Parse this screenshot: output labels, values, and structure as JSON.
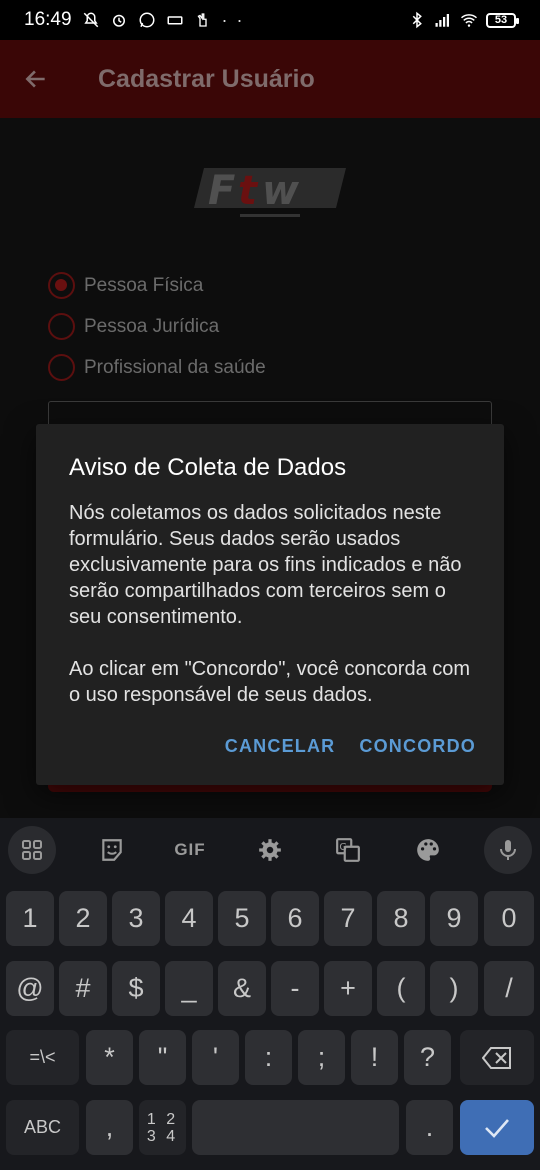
{
  "status_bar": {
    "time": "16:49",
    "battery": "53",
    "dots": "· ·"
  },
  "app_bar": {
    "title": "Cadastrar Usuário"
  },
  "form": {
    "logo_text": "FTW",
    "radio_options": [
      {
        "label": "Pessoa Física",
        "checked": true
      },
      {
        "label": "Pessoa Jurídica",
        "checked": false
      },
      {
        "label": "Profissional da saúde",
        "checked": false
      }
    ]
  },
  "dialog": {
    "title": "Aviso de Coleta de Dados",
    "body": "Nós coletamos os dados solicitados neste formulário. Seus dados serão usados exclusivamente para os fins indicados e não serão compartilhados com terceiros sem o seu consentimento.\n\nAo clicar em \"Concordo\", você concorda com o uso responsável de seus dados.",
    "cancel_label": "CANCELAR",
    "agree_label": "CONCORDO"
  },
  "keyboard": {
    "toolbar": {
      "gif_label": "GIF"
    },
    "row1": [
      "1",
      "2",
      "3",
      "4",
      "5",
      "6",
      "7",
      "8",
      "9",
      "0"
    ],
    "row2": [
      "@",
      "#",
      "$",
      "_",
      "&",
      "-",
      "+",
      "(",
      ")",
      "/"
    ],
    "row3": [
      "=\\<",
      "*",
      "\"",
      "'",
      ":",
      ";",
      "!",
      "?"
    ],
    "row4": {
      "abc": "ABC",
      "comma": ",",
      "numpad": "1 2\n3 4",
      "period": "."
    }
  },
  "colors": {
    "accent_red": "#3a0606",
    "dialog_button": "#5b9bd5",
    "enter_key": "#3f6eb5"
  }
}
